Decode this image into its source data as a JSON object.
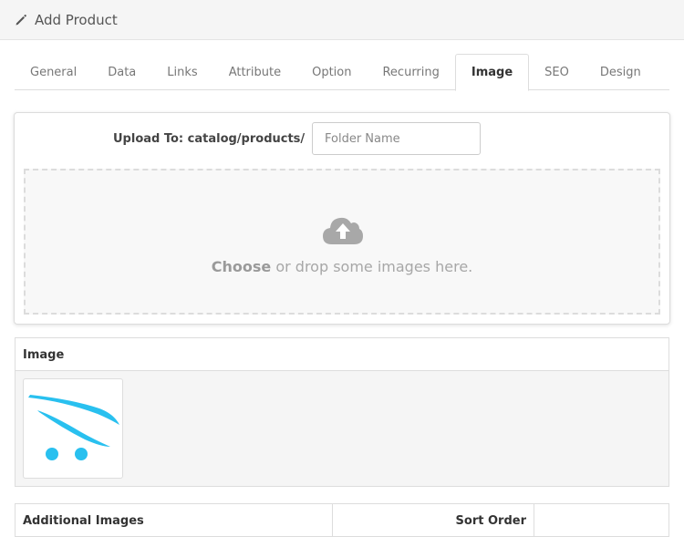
{
  "header": {
    "icon": "pencil-icon",
    "title": "Add Product"
  },
  "tabs": [
    {
      "label": "General",
      "active": false
    },
    {
      "label": "Data",
      "active": false
    },
    {
      "label": "Links",
      "active": false
    },
    {
      "label": "Attribute",
      "active": false
    },
    {
      "label": "Option",
      "active": false
    },
    {
      "label": "Recurring",
      "active": false
    },
    {
      "label": "Image",
      "active": true
    },
    {
      "label": "SEO",
      "active": false
    },
    {
      "label": "Design",
      "active": false
    }
  ],
  "upload": {
    "label": "Upload To: catalog/products/",
    "folder_placeholder": "Folder Name",
    "drop_icon": "cloud-upload-icon",
    "drop_choose": "Choose",
    "drop_rest": " or drop some images here."
  },
  "image_table": {
    "header": "Image",
    "thumbnail": "opencart-cart-logo"
  },
  "additional_images_table": {
    "headers": [
      "Additional Images",
      "Sort Order",
      ""
    ]
  },
  "colors": {
    "accent_blue": "#29c0ef",
    "border": "#dddddd",
    "heading_bg": "#f5f5f5"
  }
}
